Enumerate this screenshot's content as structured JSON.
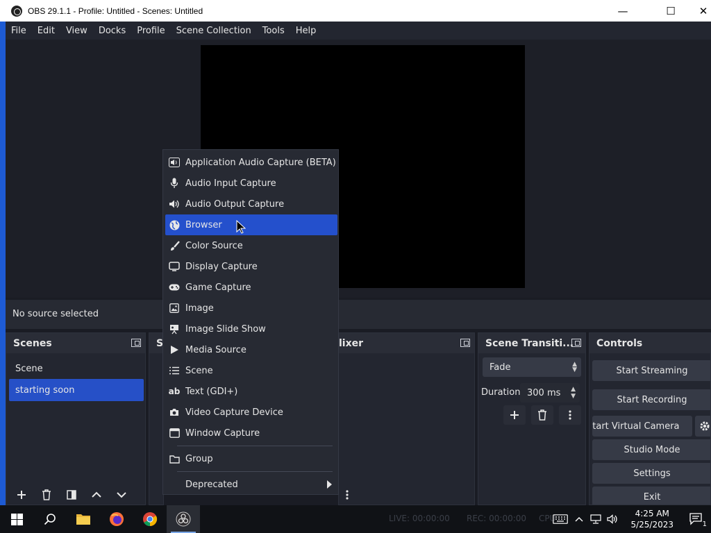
{
  "window": {
    "title": "OBS 29.1.1 - Profile: Untitled - Scenes: Untitled",
    "minimize": "—",
    "maximize": "☐",
    "close": "✕"
  },
  "menubar": [
    "File",
    "Edit",
    "View",
    "Docks",
    "Profile",
    "Scene Collection",
    "Tools",
    "Help"
  ],
  "source_bar": {
    "label": "No source selected"
  },
  "scenes": {
    "title": "Scenes",
    "items": [
      {
        "label": "Scene",
        "selected": false
      },
      {
        "label": "starting soon",
        "selected": true
      }
    ]
  },
  "sources": {
    "title_fragment": "S"
  },
  "mixer": {
    "title_fragment": "lixer"
  },
  "transitions": {
    "title": "Scene Transiti...",
    "selected": "Fade",
    "duration_label": "Duration",
    "duration_value": "300 ms"
  },
  "controls": {
    "title": "Controls",
    "buttons": [
      "Start Streaming",
      "Start Recording",
      "Start Virtual Camera",
      "Studio Mode",
      "Settings",
      "Exit"
    ]
  },
  "context_menu": {
    "items": [
      {
        "label": "Application Audio Capture (BETA)",
        "icon": "app-audio-icon"
      },
      {
        "label": "Audio Input Capture",
        "icon": "microphone-icon"
      },
      {
        "label": "Audio Output Capture",
        "icon": "speaker-icon"
      },
      {
        "label": "Browser",
        "icon": "globe-icon",
        "highlighted": true
      },
      {
        "label": "Color Source",
        "icon": "brush-icon"
      },
      {
        "label": "Display Capture",
        "icon": "monitor-icon"
      },
      {
        "label": "Game Capture",
        "icon": "gamepad-icon"
      },
      {
        "label": "Image",
        "icon": "image-icon"
      },
      {
        "label": "Image Slide Show",
        "icon": "slideshow-icon"
      },
      {
        "label": "Media Source",
        "icon": "play-icon"
      },
      {
        "label": "Scene",
        "icon": "list-icon"
      },
      {
        "label": "Text (GDI+)",
        "icon": "text-icon"
      },
      {
        "label": "Video Capture Device",
        "icon": "camera-icon"
      },
      {
        "label": "Window Capture",
        "icon": "window-icon"
      }
    ],
    "group": "Group",
    "deprecated": "Deprecated"
  },
  "statusbar": {
    "live": "LIVE: 00:00:00",
    "rec": "REC: 00:00:00",
    "cpu": "CPU"
  },
  "taskbar": {
    "time": "4:25 AM",
    "date": "5/25/2023",
    "notification_count": "1"
  },
  "colors": {
    "accent": "#2650c7",
    "background": "#1a1c24",
    "panel": "#232630"
  }
}
